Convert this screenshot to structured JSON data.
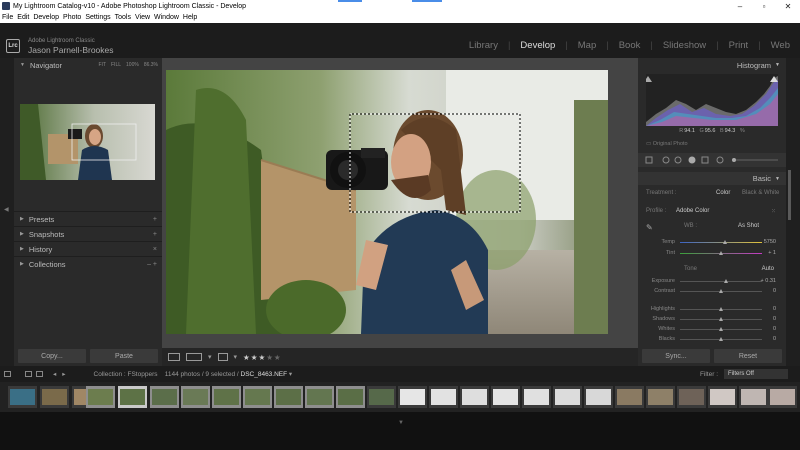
{
  "window": {
    "title": "My Lightroom Catalog-v10 - Adobe Photoshop Lightroom Classic - Develop",
    "minimize": "–",
    "maximize": "▫",
    "close": "✕"
  },
  "menu": [
    "File",
    "Edit",
    "Develop",
    "Photo",
    "Settings",
    "Tools",
    "View",
    "Window",
    "Help"
  ],
  "identity": {
    "logo": "Lrc",
    "product": "Adobe Lightroom Classic",
    "user": "Jason Parnell-Brookes"
  },
  "modules": [
    {
      "label": "Library",
      "active": false
    },
    {
      "label": "Develop",
      "active": true
    },
    {
      "label": "Map",
      "active": false
    },
    {
      "label": "Book",
      "active": false
    },
    {
      "label": "Slideshow",
      "active": false
    },
    {
      "label": "Print",
      "active": false
    },
    {
      "label": "Web",
      "active": false
    }
  ],
  "left": {
    "navigator": {
      "title": "Navigator",
      "options": [
        "FIT",
        "FILL",
        "100%",
        "86.3%"
      ]
    },
    "panels": [
      "Presets",
      "Snapshots",
      "History",
      "Collections"
    ],
    "panel_actions": [
      "+",
      "+",
      "×",
      "– +"
    ],
    "copy_label": "Copy...",
    "paste_label": "Paste"
  },
  "toolbar": {
    "stars": "★★★",
    "empty_stars": "★★"
  },
  "right": {
    "histogram": {
      "title": "Histogram",
      "r_label": "R",
      "r": "94.1",
      "g_label": "G",
      "g": "95.6",
      "b_label": "B",
      "b": "94.3",
      "unit": "%"
    },
    "original_photo": "Original Photo",
    "basic": {
      "title": "Basic",
      "treatment_label": "Treatment :",
      "treatment_color": "Color",
      "treatment_bw": "Black & White",
      "profile_label": "Profile :",
      "profile_value": "Adobe Color",
      "wb_label": "WB :",
      "wb_value": "As Shot",
      "temp_label": "Temp",
      "temp_value": "5750",
      "tint_label": "Tint",
      "tint_value": "+ 1",
      "tone_label": "Tone",
      "tone_auto": "Auto",
      "exposure_label": "Exposure",
      "exposure_value": "+ 0.31",
      "contrast_label": "Contrast",
      "contrast_value": "0",
      "highlights_label": "Highlights",
      "highlights_value": "0",
      "shadows_label": "Shadows",
      "shadows_value": "0",
      "whites_label": "Whites",
      "whites_value": "0",
      "blacks_label": "Blacks",
      "blacks_value": "0"
    },
    "sync_label": "Sync...",
    "reset_label": "Reset"
  },
  "filmbar": {
    "collection_label": "Collection : FStoppers",
    "count": "1144 photos / 9 selected /",
    "filename": "DSC_8463.NEF",
    "filter_label": "Filter :",
    "filter_value": "Filters Off"
  },
  "sliders": {
    "temp": 0.55,
    "tint": 0.5,
    "exposure": 0.56,
    "contrast": 0.5,
    "highlights": 0.5,
    "shadows": 0.5,
    "whites": 0.5,
    "blacks": 0.5
  },
  "colors": {
    "accent": "#4a8de8",
    "panel": "#2a2a2a",
    "workspace": "#444444"
  }
}
